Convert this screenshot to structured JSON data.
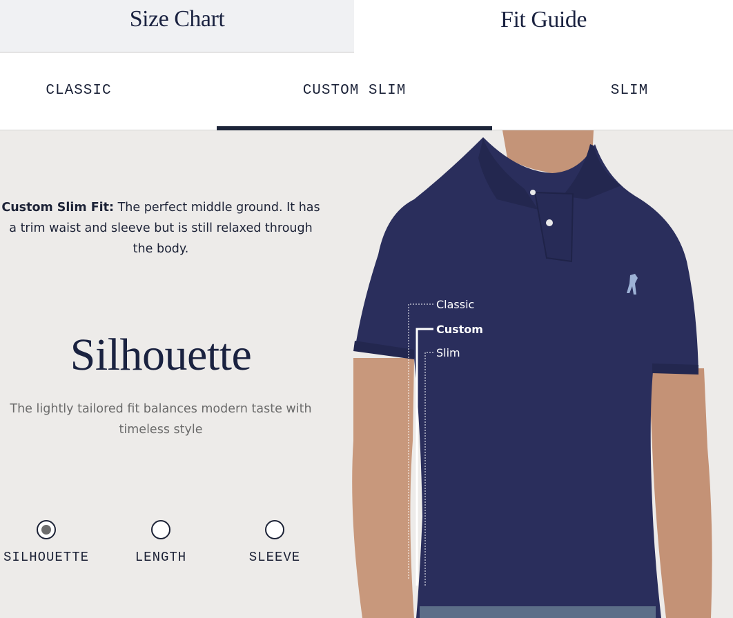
{
  "top_tabs": [
    {
      "label": "Size Chart",
      "active": false
    },
    {
      "label": "Fit Guide",
      "active": true
    }
  ],
  "fit_tabs": [
    {
      "label": "CLASSIC",
      "active": false
    },
    {
      "label": "CUSTOM SLIM",
      "active": true
    },
    {
      "label": "SLIM",
      "active": false
    }
  ],
  "description": {
    "bold": "Custom Slim Fit:",
    "text": " The perfect middle ground. It has a trim waist and sleeve but is still relaxed through the body."
  },
  "section": {
    "heading": "Silhouette",
    "subtext": "The lightly tailored fit balances modern taste with timeless style"
  },
  "fit_markers": {
    "classic": "Classic",
    "custom": "Custom",
    "slim": "Slim"
  },
  "view_options": [
    {
      "label": "SILHOUETTE",
      "selected": true
    },
    {
      "label": "LENGTH",
      "selected": false
    },
    {
      "label": "SLEEVE",
      "selected": false
    }
  ],
  "colors": {
    "shirt": "#2a2e5c",
    "background": "#edebe9",
    "accent": "#1c2438"
  }
}
